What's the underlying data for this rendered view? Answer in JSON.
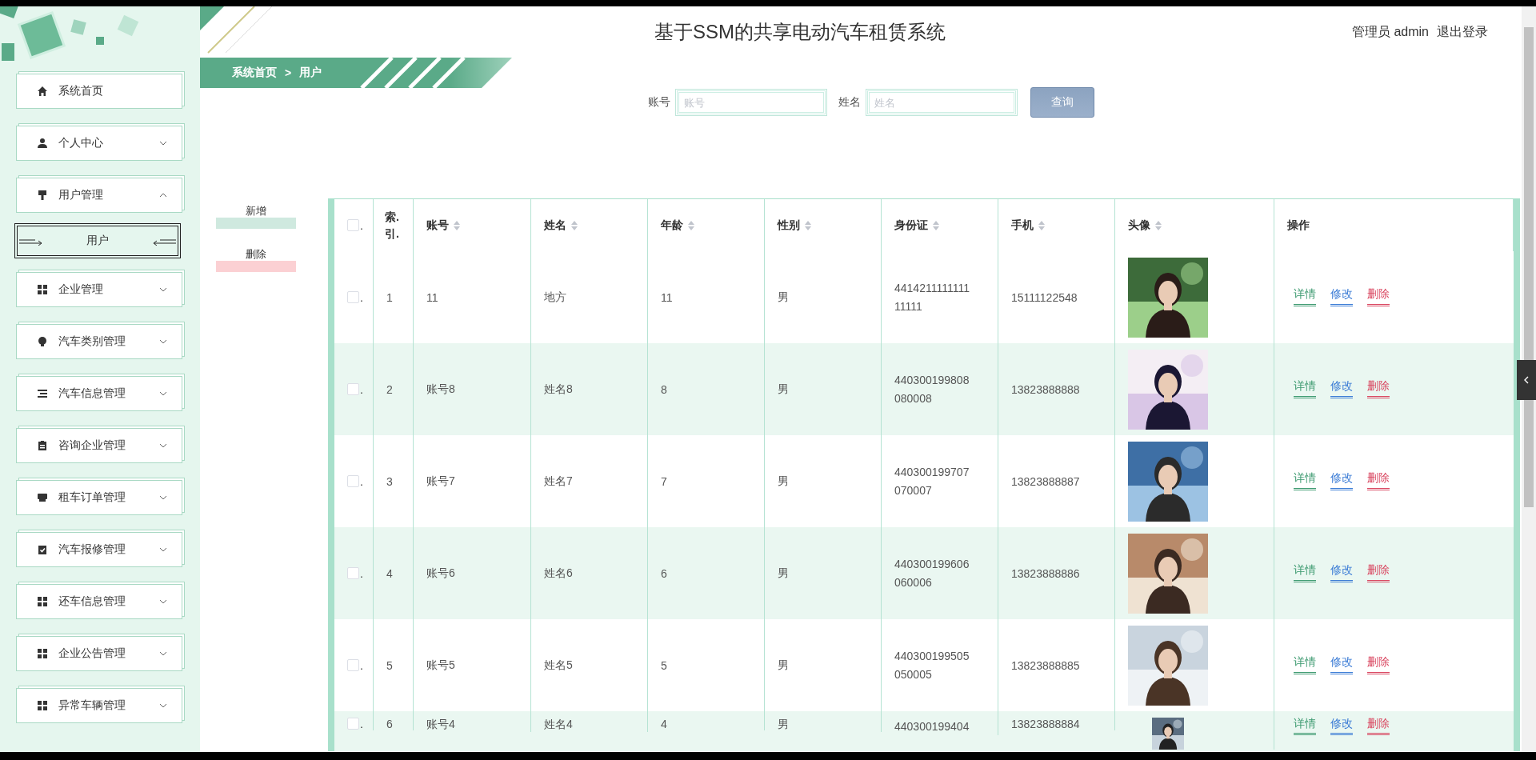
{
  "header": {
    "title": "基于SSM的共享电动汽车租赁系统",
    "user_role": "管理员",
    "user_name": "admin",
    "logout": "退出登录"
  },
  "breadcrumb": {
    "items": [
      "系统首页",
      "用户"
    ],
    "separator": ">"
  },
  "sidebar": {
    "items": [
      {
        "label": "系统首页"
      },
      {
        "label": "个人中心",
        "expanded": false
      },
      {
        "label": "用户管理",
        "expanded": true,
        "children": [
          {
            "label": "用户",
            "selected": true
          }
        ]
      },
      {
        "label": "企业管理",
        "expanded": false
      },
      {
        "label": "汽车类别管理",
        "expanded": false
      },
      {
        "label": "汽车信息管理",
        "expanded": false
      },
      {
        "label": "咨询企业管理",
        "expanded": false
      },
      {
        "label": "租车订单管理",
        "expanded": false
      },
      {
        "label": "汽车报修管理",
        "expanded": false
      },
      {
        "label": "还车信息管理",
        "expanded": false
      },
      {
        "label": "企业公告管理",
        "expanded": false
      },
      {
        "label": "异常车辆管理",
        "expanded": false
      }
    ]
  },
  "search": {
    "fields": [
      {
        "label": "账号",
        "placeholder": "账号"
      },
      {
        "label": "姓名",
        "placeholder": "姓名"
      }
    ],
    "button": "查询"
  },
  "actions": [
    {
      "label": "新增",
      "kind": "add"
    },
    {
      "label": "删除",
      "kind": "delete"
    }
  ],
  "table": {
    "select_column": {
      "checked": false,
      "tail": "."
    },
    "columns": [
      {
        "label_lines": [
          "索.",
          "引."
        ],
        "sortable": false
      },
      {
        "label": "账号",
        "sortable": true
      },
      {
        "label": "姓名",
        "sortable": true
      },
      {
        "label": "年龄",
        "sortable": true
      },
      {
        "label": "性别",
        "sortable": true
      },
      {
        "label": "身份证",
        "sortable": true
      },
      {
        "label": "手机",
        "sortable": true
      },
      {
        "label": "头像",
        "sortable": true
      },
      {
        "label": "操作",
        "sortable": false
      }
    ],
    "rows": [
      {
        "checked": false,
        "tail": ".",
        "index": "1",
        "account": "11",
        "name": "地方",
        "age": "11",
        "gender": "男",
        "id_card": "441421111111111111",
        "phone": "15111122548",
        "actions": [
          {
            "label": "详情",
            "color": "#3d9a70"
          },
          {
            "label": "修改",
            "color": "#3a7bd5"
          },
          {
            "label": "删除",
            "color": "#d9455f"
          }
        ]
      },
      {
        "checked": false,
        "tail": ".",
        "index": "2",
        "account": "账号8",
        "name": "姓名8",
        "age": "8",
        "gender": "男",
        "id_card": "440300199808080008",
        "phone": "13823888888",
        "actions": [
          {
            "label": "详情",
            "color": "#3d9a70"
          },
          {
            "label": "修改",
            "color": "#3a7bd5"
          },
          {
            "label": "删除",
            "color": "#d9455f"
          }
        ]
      },
      {
        "checked": false,
        "tail": ".",
        "index": "3",
        "account": "账号7",
        "name": "姓名7",
        "age": "7",
        "gender": "男",
        "id_card": "440300199707070007",
        "phone": "13823888887",
        "actions": [
          {
            "label": "详情",
            "color": "#3d9a70"
          },
          {
            "label": "修改",
            "color": "#3a7bd5"
          },
          {
            "label": "删除",
            "color": "#d9455f"
          }
        ]
      },
      {
        "checked": false,
        "tail": ".",
        "index": "4",
        "account": "账号6",
        "name": "姓名6",
        "age": "6",
        "gender": "男",
        "id_card": "440300199606060006",
        "phone": "13823888886",
        "actions": [
          {
            "label": "详情",
            "color": "#3d9a70"
          },
          {
            "label": "修改",
            "color": "#3a7bd5"
          },
          {
            "label": "删除",
            "color": "#d9455f"
          }
        ]
      },
      {
        "checked": false,
        "tail": ".",
        "index": "5",
        "account": "账号5",
        "name": "姓名5",
        "age": "5",
        "gender": "男",
        "id_card": "440300199505050005",
        "phone": "13823888885",
        "actions": [
          {
            "label": "详情",
            "color": "#3d9a70"
          },
          {
            "label": "修改",
            "color": "#3a7bd5"
          },
          {
            "label": "删除",
            "color": "#d9455f"
          }
        ]
      },
      {
        "checked": false,
        "tail": ".",
        "index": "6",
        "account": "账号4",
        "name": "姓名4",
        "age": "4",
        "gender": "男",
        "id_card": "440300199404",
        "phone": "13823888884",
        "actions": [
          {
            "label": "详情",
            "color": "#3d9a70"
          },
          {
            "label": "修改",
            "color": "#3a7bd5"
          },
          {
            "label": "删除",
            "color": "#d9455f"
          }
        ]
      }
    ]
  }
}
